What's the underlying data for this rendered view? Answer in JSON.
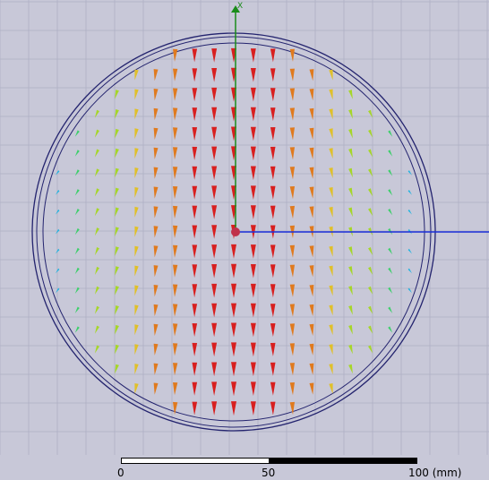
{
  "viewport": {
    "background": "#c8c8d8",
    "grid_color": "#aeb0c4",
    "outline_color": "#23236e",
    "x_axis_label": "X",
    "x_axis_color": "#1a8c1a",
    "y_axis_color": "#1b2fd8",
    "origin_color": "#c0304a",
    "field_arrows": {
      "rows": 22,
      "columns": 21,
      "color_scale": [
        "#1fb3e0",
        "#3ccf6a",
        "#a6d62a",
        "#e0c02a",
        "#e07a1e",
        "#d81f1f"
      ]
    }
  },
  "scale": {
    "labels": [
      "0",
      "50",
      "100 (mm)"
    ],
    "segment_colors": [
      "#ffffff",
      "#000000"
    ]
  }
}
